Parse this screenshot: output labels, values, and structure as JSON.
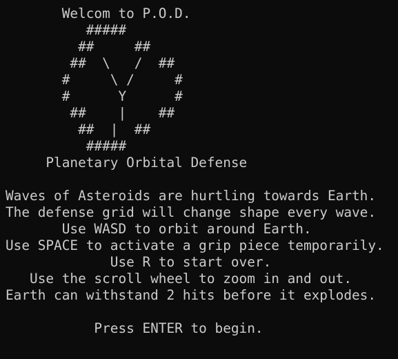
{
  "terminal": {
    "lines": [
      "       Welcom to P.O.D.",
      "          #####",
      "         ##     ##",
      "        ##  \\   /  ##",
      "       #     \\ /     #",
      "       #      Y      #",
      "        ##    |    ##",
      "         ##  |  ##",
      "          #####",
      "     Planetary Orbital Defense",
      "",
      "Waves of Asteroids are hurtling towards Earth.",
      "The defense grid will change shape every wave.",
      "       Use WASD to orbit around Earth.",
      "Use SPACE to activate a grip piece temporarily.",
      "             Use R to start over.",
      "   Use the scroll wheel to zoom in and out.",
      "Earth can withstand 2 hits before it explodes.",
      "",
      "           Press ENTER to begin."
    ]
  },
  "colors": {
    "background": "#0c0c0c",
    "text": "#cccccc"
  }
}
